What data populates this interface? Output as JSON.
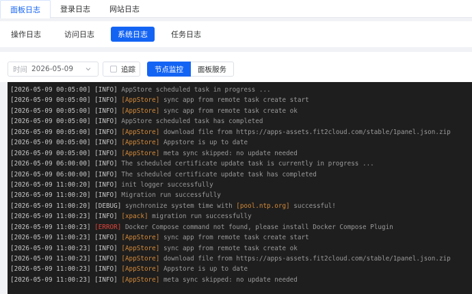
{
  "top_tabs": [
    {
      "label": "面板日志",
      "active": true
    },
    {
      "label": "登录日志",
      "active": false
    },
    {
      "label": "网站日志",
      "active": false
    }
  ],
  "sub_tabs": [
    {
      "label": "操作日志",
      "active": false
    },
    {
      "label": "访问日志",
      "active": false
    },
    {
      "label": "系统日志",
      "active": true
    },
    {
      "label": "任务日志",
      "active": false
    }
  ],
  "controls": {
    "date_label": "时间",
    "date_value": "2026-05-09",
    "track_label": "追踪",
    "segment": [
      {
        "label": "节点监控",
        "active": true
      },
      {
        "label": "面板服务",
        "active": false
      }
    ]
  },
  "colors": {
    "accent": "#1464f4",
    "console_bg": "#1e1e1e",
    "tag_color": "#d48a3a",
    "error_color": "#e0453a"
  },
  "log_lines": [
    {
      "ts": "[2026-05-09 00:05:00]",
      "level": "[INFO]",
      "tag": "",
      "message": "AppStore scheduled task in progress ..."
    },
    {
      "ts": "[2026-05-09 00:05:00]",
      "level": "[INFO]",
      "tag": "[AppStore]",
      "message": "sync app from remote task create start"
    },
    {
      "ts": "[2026-05-09 00:05:00]",
      "level": "[INFO]",
      "tag": "[AppStore]",
      "message": "sync app from remote task create ok"
    },
    {
      "ts": "[2026-05-09 00:05:00]",
      "level": "[INFO]",
      "tag": "",
      "message": "AppStore scheduled task has completed"
    },
    {
      "ts": "[2026-05-09 00:05:00]",
      "level": "[INFO]",
      "tag": "[AppStore]",
      "message": "download file from https://apps-assets.fit2cloud.com/stable/1panel.json.zip"
    },
    {
      "ts": "[2026-05-09 00:05:00]",
      "level": "[INFO]",
      "tag": "[AppStore]",
      "message": "Appstore is up to date"
    },
    {
      "ts": "[2026-05-09 00:05:00]",
      "level": "[INFO]",
      "tag": "[AppStore]",
      "message": "meta sync skipped: no update needed"
    },
    {
      "ts": "[2026-05-09 06:00:00]",
      "level": "[INFO]",
      "tag": "",
      "message": "The scheduled certificate update task is currently in progress ..."
    },
    {
      "ts": "[2026-05-09 06:00:00]",
      "level": "[INFO]",
      "tag": "",
      "message": "The scheduled certificate update task has completed"
    },
    {
      "ts": "[2026-05-09 11:00:20]",
      "level": "[INFO]",
      "tag": "",
      "message": "init logger successfully"
    },
    {
      "ts": "[2026-05-09 11:00:20]",
      "level": "[INFO]",
      "tag": "",
      "message": "Migration run successfully"
    },
    {
      "ts": "[2026-05-09 11:00:20]",
      "level": "[DEBUG]",
      "tag": "",
      "message_pre": "synchronize system time with ",
      "highlight": "[pool.ntp.org]",
      "message_post": " successful!"
    },
    {
      "ts": "[2026-05-09 11:00:23]",
      "level": "[INFO]",
      "tag": "[xpack]",
      "message": "migration run successfully"
    },
    {
      "ts": "[2026-05-09 11:00:23]",
      "level": "[ERROR]",
      "tag": "",
      "message": "Docker Compose command not found, please install Docker Compose Plugin"
    },
    {
      "ts": "[2026-05-09 11:00:23]",
      "level": "[INFO]",
      "tag": "[AppStore]",
      "message": "sync app from remote task create start"
    },
    {
      "ts": "[2026-05-09 11:00:23]",
      "level": "[INFO]",
      "tag": "[AppStore]",
      "message": "sync app from remote task create ok"
    },
    {
      "ts": "[2026-05-09 11:00:23]",
      "level": "[INFO]",
      "tag": "[AppStore]",
      "message": "download file from https://apps-assets.fit2cloud.com/stable/1panel.json.zip"
    },
    {
      "ts": "[2026-05-09 11:00:23]",
      "level": "[INFO]",
      "tag": "[AppStore]",
      "message": "Appstore is up to date"
    },
    {
      "ts": "[2026-05-09 11:00:23]",
      "level": "[INFO]",
      "tag": "[AppStore]",
      "message": "meta sync skipped: no update needed"
    }
  ]
}
